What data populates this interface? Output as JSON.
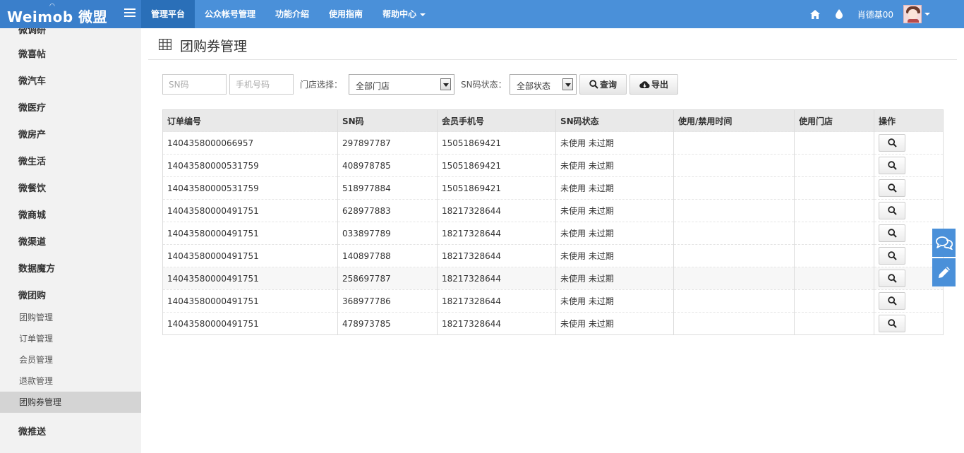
{
  "brand": {
    "logo": "Weimob 微盟"
  },
  "nav": {
    "items": [
      {
        "label": "管理平台"
      },
      {
        "label": "公众帐号管理"
      },
      {
        "label": "功能介绍"
      },
      {
        "label": "使用指南"
      },
      {
        "label": "帮助中心"
      }
    ],
    "active_index": 0
  },
  "user": {
    "name": "肖德基00"
  },
  "sidebar": {
    "cut_item": "微调研",
    "items": [
      {
        "label": "微喜帖"
      },
      {
        "label": "微汽车"
      },
      {
        "label": "微医疗"
      },
      {
        "label": "微房产"
      },
      {
        "label": "微生活"
      },
      {
        "label": "微餐饮"
      },
      {
        "label": "微商城"
      },
      {
        "label": "微渠道"
      },
      {
        "label": "数据魔方"
      },
      {
        "label": "微团购"
      }
    ],
    "subitems": [
      {
        "label": "团购管理"
      },
      {
        "label": "订单管理"
      },
      {
        "label": "会员管理"
      },
      {
        "label": "退款管理"
      },
      {
        "label": "团购券管理"
      }
    ],
    "active_sub": "团购券管理",
    "after_item": "微推送"
  },
  "page": {
    "title": "团购券管理"
  },
  "filter": {
    "sn_placeholder": "SN码",
    "phone_placeholder": "手机号码",
    "store_label": "门店选择：",
    "store_value": "全部门店",
    "status_label": "SN码状态：",
    "status_value": "全部状态",
    "query_label": "查询",
    "export_label": "导出"
  },
  "table": {
    "headers": [
      "订单编号",
      "SN码",
      "会员手机号",
      "SN码状态",
      "使用/禁用时间",
      "使用门店",
      "操作"
    ],
    "rows": [
      {
        "order": "1404358000066957",
        "sn": "297897787",
        "phone": "15051869421",
        "status": "未使用 未过期",
        "time": "",
        "store": ""
      },
      {
        "order": "14043580000531759",
        "sn": "408978785",
        "phone": "15051869421",
        "status": "未使用 未过期",
        "time": "",
        "store": ""
      },
      {
        "order": "14043580000531759",
        "sn": "518977884",
        "phone": "15051869421",
        "status": "未使用 未过期",
        "time": "",
        "store": ""
      },
      {
        "order": "14043580000491751",
        "sn": "628977883",
        "phone": "18217328644",
        "status": "未使用 未过期",
        "time": "",
        "store": ""
      },
      {
        "order": "14043580000491751",
        "sn": "033897789",
        "phone": "18217328644",
        "status": "未使用 未过期",
        "time": "",
        "store": ""
      },
      {
        "order": "14043580000491751",
        "sn": "140897788",
        "phone": "18217328644",
        "status": "未使用 未过期",
        "time": "",
        "store": ""
      },
      {
        "order": "14043580000491751",
        "sn": "258697787",
        "phone": "18217328644",
        "status": "未使用 未过期",
        "time": "",
        "store": ""
      },
      {
        "order": "14043580000491751",
        "sn": "368977786",
        "phone": "18217328644",
        "status": "未使用 未过期",
        "time": "",
        "store": ""
      },
      {
        "order": "14043580000491751",
        "sn": "478973785",
        "phone": "18217328644",
        "status": "未使用 未过期",
        "time": "",
        "store": ""
      }
    ],
    "highlighted_row": 6
  },
  "icons": {
    "home": "home-icon",
    "drop": "drop-icon",
    "search": "search-icon",
    "cloud": "cloud-download-icon",
    "chat": "chat-icon",
    "edit": "pencil-icon",
    "table": "table-icon"
  },
  "colors": {
    "topbar": "#4a90d9",
    "brand": "#3a7fcb",
    "nav_active": "#2a6fb8",
    "sidebar_bg": "#f2f2f2",
    "sidebar_active": "#d4d4d4"
  }
}
